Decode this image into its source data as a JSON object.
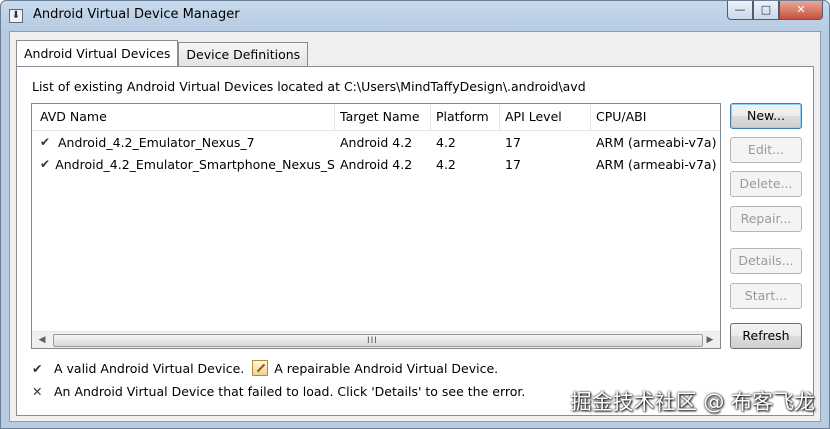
{
  "window": {
    "title": "Android Virtual Device Manager",
    "controls": {
      "minimize": "—",
      "maximize": "□",
      "close": "✕"
    }
  },
  "tabs": [
    {
      "label": "Android Virtual Devices",
      "active": true
    },
    {
      "label": "Device Definitions",
      "active": false
    }
  ],
  "path_label": "List of existing Android Virtual Devices located at C:\\Users\\MindTaffyDesign\\.android\\avd",
  "table": {
    "columns": [
      "AVD Name",
      "Target Name",
      "Platform",
      "API Level",
      "CPU/ABI"
    ],
    "rows": [
      {
        "status_icon": "checkmark-icon",
        "name": "Android_4.2_Emulator_Nexus_7",
        "target": "Android 4.2",
        "platform": "4.2",
        "api": "17",
        "cpu": "ARM (armeabi-v7a)"
      },
      {
        "status_icon": "checkmark-icon",
        "name": "Android_4.2_Emulator_Smartphone_Nexus_S",
        "target": "Android 4.2",
        "platform": "4.2",
        "api": "17",
        "cpu": "ARM (armeabi-v7a)"
      }
    ],
    "scroll_grip": "III"
  },
  "buttons": {
    "new": "New...",
    "edit": "Edit...",
    "delete": "Delete...",
    "repair": "Repair...",
    "details": "Details...",
    "start": "Start...",
    "refresh": "Refresh"
  },
  "legend": {
    "valid": "A valid Android Virtual Device.",
    "repairable": "A repairable Android Virtual Device.",
    "failed": "An Android Virtual Device that failed to load. Click 'Details' to see the error."
  },
  "watermark": "掘金技术社区 @ 布客飞龙"
}
